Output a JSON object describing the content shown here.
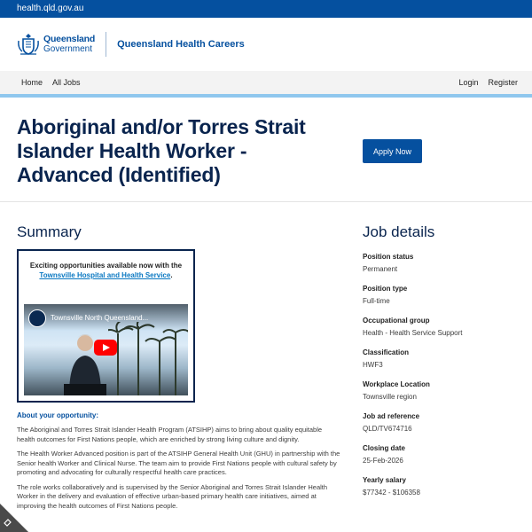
{
  "topbar": {
    "domain": "health.qld.gov.au"
  },
  "header": {
    "logo_line1": "Queensland",
    "logo_line2": "Government",
    "site_title": "Queensland Health Careers"
  },
  "nav": {
    "left": [
      {
        "label": "Home"
      },
      {
        "label": "All Jobs"
      }
    ],
    "right": [
      {
        "label": "Login"
      },
      {
        "label": "Register"
      }
    ]
  },
  "hero": {
    "title": "Aboriginal and/or Torres Strait Islander Health Worker - Advanced (Identified)",
    "apply_label": "Apply Now"
  },
  "summary": {
    "heading": "Summary",
    "video_caption_prefix": "Exciting opportunities available now with the",
    "video_caption_link": "Townsville Hospital and Health Service",
    "video_caption_suffix": ".",
    "video_title": "Townsville North Queensland...",
    "about_heading": "About your opportunity:",
    "paragraphs": [
      "The Aboriginal and Torres Strait Islander Health Program (ATSIHP) aims to bring about quality equitable health outcomes for First Nations people, which are enriched by strong living culture and dignity.",
      "The Health Worker Advanced position is part of the ATSIHP General Health Unit (GHU) in partnership with the Senior health Worker and Clinical Nurse. The team aim to provide First Nations people with cultural safety by promoting and advocating for culturally respectful health care practices.",
      "The role works collaboratively and is supervised by the Senior Aboriginal and Torres Strait Islander Health Worker in the delivery and evaluation of effective urban-based primary health care initiatives, aimed at improving the health outcomes of First Nations people."
    ]
  },
  "job_details": {
    "heading": "Job details",
    "items": [
      {
        "label": "Position status",
        "value": "Permanent"
      },
      {
        "label": "Position type",
        "value": "Full-time"
      },
      {
        "label": "Occupational group",
        "value": "Health - Health Service Support"
      },
      {
        "label": "Classification",
        "value": "HWF3"
      },
      {
        "label": "Workplace Location",
        "value": "Townsville region"
      },
      {
        "label": "Job ad reference",
        "value": "QLD/TV674716"
      },
      {
        "label": "Closing date",
        "value": "25-Feb-2026"
      },
      {
        "label": "Yearly salary",
        "value": "$77342 - $106358"
      }
    ]
  },
  "colors": {
    "brand_blue": "#05509f",
    "heading_navy": "#09244e",
    "nav_accent": "#8fc7ee",
    "link_blue": "#0a78c2"
  }
}
